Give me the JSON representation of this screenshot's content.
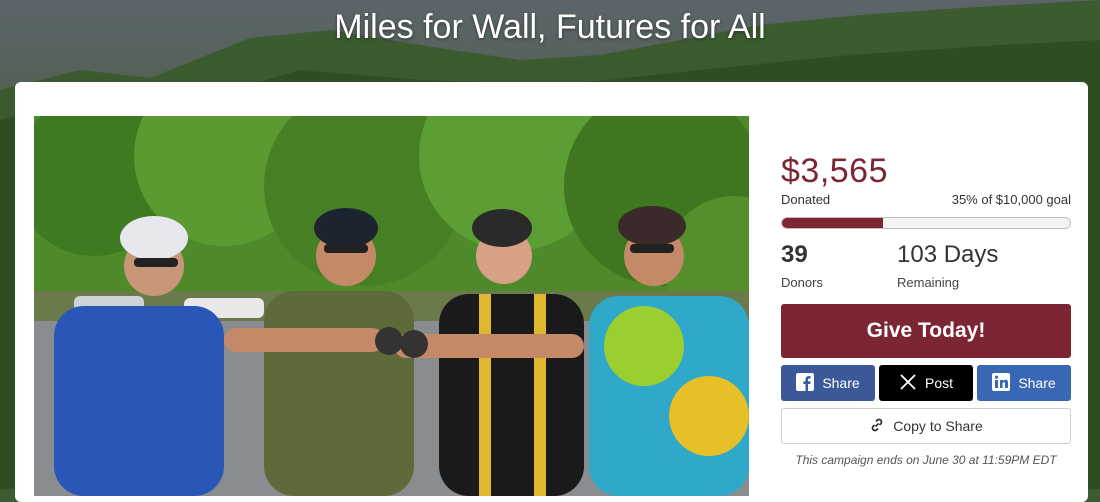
{
  "hero": {
    "title": "Miles for Wall, Futures for All"
  },
  "photo": {
    "alt_icon": "cyclists-photo"
  },
  "campaign": {
    "amount": "$3,565",
    "donated_label": "Donated",
    "goal_text": "35% of $10,000 goal",
    "progress_fraction": 0.35,
    "donors_count": "39",
    "donors_label": "Donors",
    "days_remaining": "103 Days",
    "remaining_label": "Remaining",
    "give_label": "Give Today!",
    "share_facebook_label": "Share",
    "share_x_label": "Post",
    "share_linkedin_label": "Share",
    "copy_label": "Copy to Share",
    "ends_text": "This campaign ends on June 30 at 11:59PM EDT"
  },
  "colors": {
    "brand": "#7d2633",
    "facebook": "#3b5998",
    "x": "#000000",
    "linkedin": "#3867b3"
  }
}
